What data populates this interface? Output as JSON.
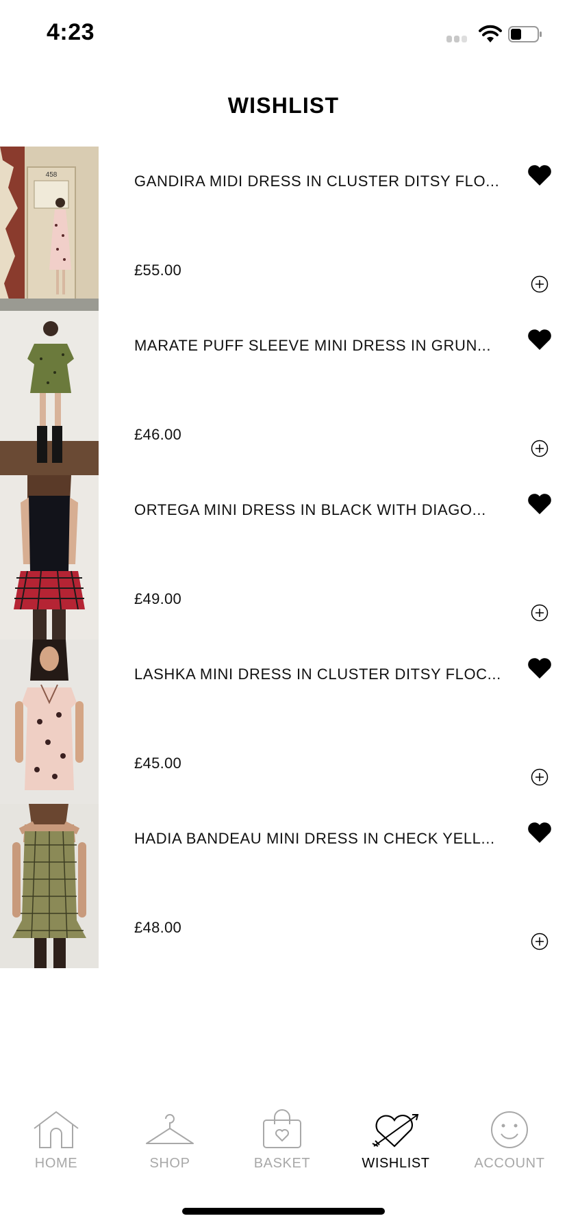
{
  "status_bar": {
    "time": "4:23"
  },
  "page_title": "WISHLIST",
  "items": [
    {
      "name": "GANDIRA MIDI DRESS IN CLUSTER DITSY FLO...",
      "price": "£55.00"
    },
    {
      "name": "MARATE PUFF SLEEVE MINI DRESS IN GRUN...",
      "price": "£46.00"
    },
    {
      "name": "ORTEGA MINI DRESS IN BLACK WITH DIAGO...",
      "price": "£49.00"
    },
    {
      "name": "LASHKA MINI DRESS IN CLUSTER DITSY FLOC...",
      "price": "£45.00"
    },
    {
      "name": "HADIA BANDEAU MINI DRESS IN CHECK YELL...",
      "price": "£48.00"
    }
  ],
  "tabbar": {
    "home": "HOME",
    "shop": "SHOP",
    "basket": "BASKET",
    "wishlist": "WISHLIST",
    "account": "ACCOUNT"
  },
  "colors": {
    "active": "#000000",
    "inactive": "#a8a8a8",
    "background": "#ffffff"
  }
}
